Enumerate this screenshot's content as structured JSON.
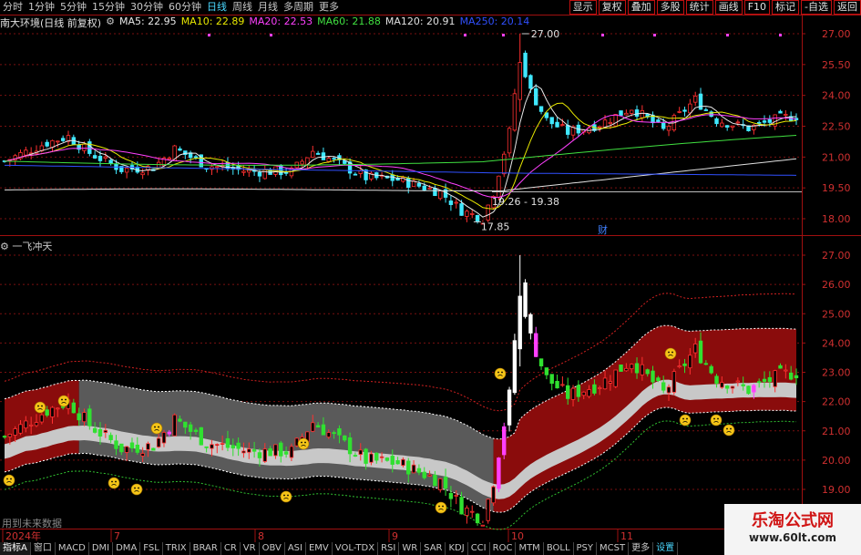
{
  "periods": [
    "分时",
    "1分钟",
    "5分钟",
    "15分钟",
    "30分钟",
    "60分钟",
    "日线",
    "周线",
    "月线",
    "多周期",
    "更多"
  ],
  "active_period": "日线",
  "right_buttons": [
    "显示",
    "复权",
    "叠加",
    "多股",
    "统计",
    "画线",
    "F10",
    "标记",
    "-自选",
    "返回"
  ],
  "stock_title": "南大环境(日线 前复权)",
  "ma": [
    {
      "label": "MA5: 22.95",
      "color": "#e8e8e8"
    },
    {
      "label": "MA10: 22.89",
      "color": "#e8e800"
    },
    {
      "label": "MA20: 22.53",
      "color": "#ff40ff"
    },
    {
      "label": "MA60: 21.88",
      "color": "#40e040"
    },
    {
      "label": "MA120: 20.91",
      "color": "#e0e0e0"
    },
    {
      "label": "MA250: 20.14",
      "color": "#3050ff"
    }
  ],
  "main_axis": [
    "27.00",
    "25.50",
    "24.00",
    "22.50",
    "21.00",
    "19.50",
    "18.00"
  ],
  "annotations": {
    "high": "27.00",
    "low": "17.85",
    "range": "19.26 - 19.38",
    "cai": "财"
  },
  "indicator_title": "一飞冲天",
  "sub_axis": [
    "27.00",
    "26.00",
    "25.00",
    "24.00",
    "23.00",
    "22.00",
    "21.00",
    "20.00",
    "19.00"
  ],
  "date_labels": [
    "2024年",
    "7",
    "8",
    "9",
    "10",
    "11"
  ],
  "no_future": "用到未来数据",
  "tabs": [
    "指标A",
    "窗口",
    "MACD",
    "DMI",
    "DMA",
    "FSL",
    "TRIX",
    "BRAR",
    "CR",
    "VR",
    "OBV",
    "ASI",
    "EMV",
    "VOL-TDX",
    "RSI",
    "WR",
    "SAR",
    "KDJ",
    "CCI",
    "ROC",
    "MTM",
    "BOLL",
    "PSY",
    "MCST",
    "更多",
    "设置"
  ],
  "watermark": {
    "line1": "乐淘公式网",
    "line2": "www.60lt.com"
  }
}
